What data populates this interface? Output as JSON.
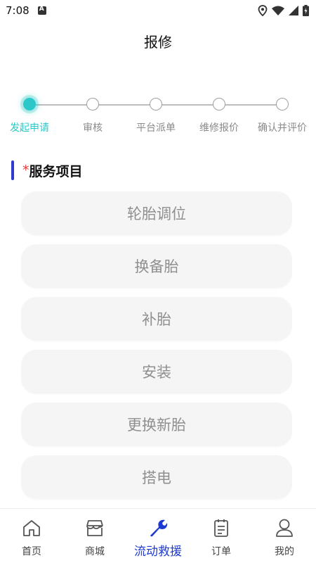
{
  "status": {
    "time": "7:08"
  },
  "header": {
    "title": "报修"
  },
  "steps": [
    {
      "label": "发起申请",
      "active": true
    },
    {
      "label": "审核",
      "active": false
    },
    {
      "label": "平台派单",
      "active": false
    },
    {
      "label": "维修报价",
      "active": false
    },
    {
      "label": "确认并评价",
      "active": false
    }
  ],
  "section": {
    "required_mark": "*",
    "title": "服务项目"
  },
  "services": [
    "轮胎调位",
    "换备胎",
    "补胎",
    "安装",
    "更换新胎",
    "搭电"
  ],
  "tabs": [
    {
      "label": "首页",
      "icon": "home-icon"
    },
    {
      "label": "商城",
      "icon": "store-icon"
    },
    {
      "label": "流动救援",
      "icon": "wrench-icon"
    },
    {
      "label": "订单",
      "icon": "order-icon"
    },
    {
      "label": "我的",
      "icon": "user-icon"
    }
  ],
  "colors": {
    "accent": "#2cc7c9",
    "brand": "#1f3bcf",
    "required": "#e53935"
  }
}
